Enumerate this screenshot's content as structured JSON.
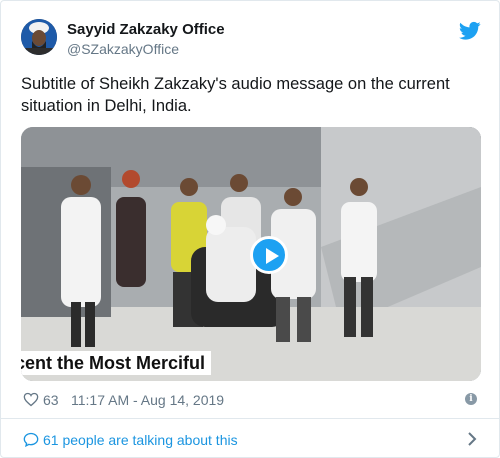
{
  "tweet": {
    "author_name": "Sayyid Zakzaky Office",
    "author_handle": "@SZakzakyOffice",
    "text": "Subtitle of Sheikh Zakzaky's audio message on the current situation in Delhi, India.",
    "media": {
      "caption": "cent the Most Merciful",
      "type": "video"
    },
    "likes": "63",
    "timestamp": "11:17 AM - Aug 14, 2019",
    "talking_label": "61 people are talking about this"
  },
  "colors": {
    "twitter_blue": "#1da1f2",
    "link_blue": "#1b95e0",
    "secondary_text": "#657786",
    "border": "#e1e8ed"
  },
  "icons": {
    "bird": "twitter-bird-icon",
    "heart": "heart-icon",
    "info": "info-icon",
    "bubble": "comment-bubble-icon",
    "chevron": "chevron-right-icon",
    "play": "play-icon"
  }
}
